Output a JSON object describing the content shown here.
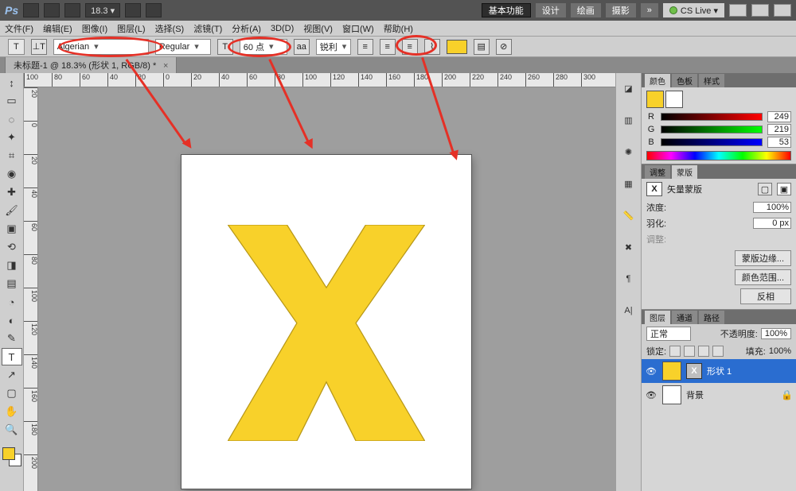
{
  "appbar": {
    "logo": "Ps",
    "zoom": "18.3 ▾",
    "workspaces": [
      "基本功能",
      "设计",
      "绘画",
      "摄影"
    ],
    "active_workspace": 0,
    "more": "»",
    "cslive": "CS Live ▾"
  },
  "menubar": [
    "文件(F)",
    "编辑(E)",
    "图像(I)",
    "图层(L)",
    "选择(S)",
    "滤镜(T)",
    "分析(A)",
    "3D(D)",
    "视图(V)",
    "窗口(W)",
    "帮助(H)"
  ],
  "optbar": {
    "tool": "T",
    "orient_icon": "⊥T",
    "font_family": "Algerian",
    "font_style": "Regular",
    "size_icon": "T",
    "font_size": "60 点",
    "aa_label": "aa",
    "aa_value": "锐利",
    "color_hex": "#f8d12a"
  },
  "tabstrip": {
    "tab": "未标题-1 @ 18.3% (形状 1, RGB/8) *"
  },
  "tools": {
    "items": [
      "move",
      "marquee",
      "lasso",
      "wand",
      "crop",
      "eyedrop",
      "heal",
      "brush",
      "stamp",
      "history",
      "eraser",
      "grad",
      "blur",
      "dodge",
      "pen",
      "type",
      "path",
      "rect",
      "hand",
      "zoom"
    ],
    "glyphs": [
      "↕",
      "▭",
      "◌",
      "✦",
      "⌗",
      "◉",
      "✚",
      "🖌",
      "▣",
      "⟲",
      "◨",
      "▤",
      "◔",
      "◐",
      "✎",
      "T",
      "↗",
      "▢",
      "✋",
      "🔍"
    ],
    "selected": "type"
  },
  "ruler_h": [
    "100",
    "80",
    "60",
    "40",
    "20",
    "0",
    "20",
    "40",
    "60",
    "80",
    "100",
    "120",
    "140",
    "160",
    "180",
    "200",
    "220",
    "240",
    "260",
    "280",
    "300"
  ],
  "ruler_v": [
    "20",
    "0",
    "20",
    "40",
    "60",
    "80",
    "100",
    "120",
    "140",
    "160",
    "180",
    "200"
  ],
  "canvas": {
    "shape_fill": "#f8d12a",
    "shape_stroke": "#b79717"
  },
  "rightstrip_icons": [
    "swatch",
    "histo",
    "star",
    "image",
    "ruler",
    "brush",
    "para",
    "clone"
  ],
  "color_panel": {
    "tabs": [
      "颜色",
      "色板",
      "样式"
    ],
    "fg": "#f8d12a",
    "bg": "#ffffff",
    "r": "249",
    "g": "219",
    "b": "53"
  },
  "mask_panel": {
    "tabs": [
      "调整",
      "蒙版"
    ],
    "title": "矢量蒙版",
    "density_label": "浓度:",
    "density_value": "100%",
    "feather_label": "羽化:",
    "feather_value": "0 px",
    "adjust_label": "调整:",
    "edge_btn": "蒙版边缘...",
    "range_btn": "颜色范围...",
    "invert_btn": "反相"
  },
  "layers_panel": {
    "tabs": [
      "图层",
      "通道",
      "路径"
    ],
    "blend_mode": "正常",
    "opacity_label": "不透明度:",
    "opacity_value": "100%",
    "lock_label": "锁定:",
    "fill_label": "填充:",
    "fill_value": "100%",
    "layers": [
      {
        "name": "形状 1",
        "selected": true,
        "thumb_color": "#f8d12a",
        "has_mask": true,
        "locked": false
      },
      {
        "name": "背景",
        "selected": false,
        "thumb_color": "#ffffff",
        "has_mask": false,
        "locked": true
      }
    ]
  }
}
